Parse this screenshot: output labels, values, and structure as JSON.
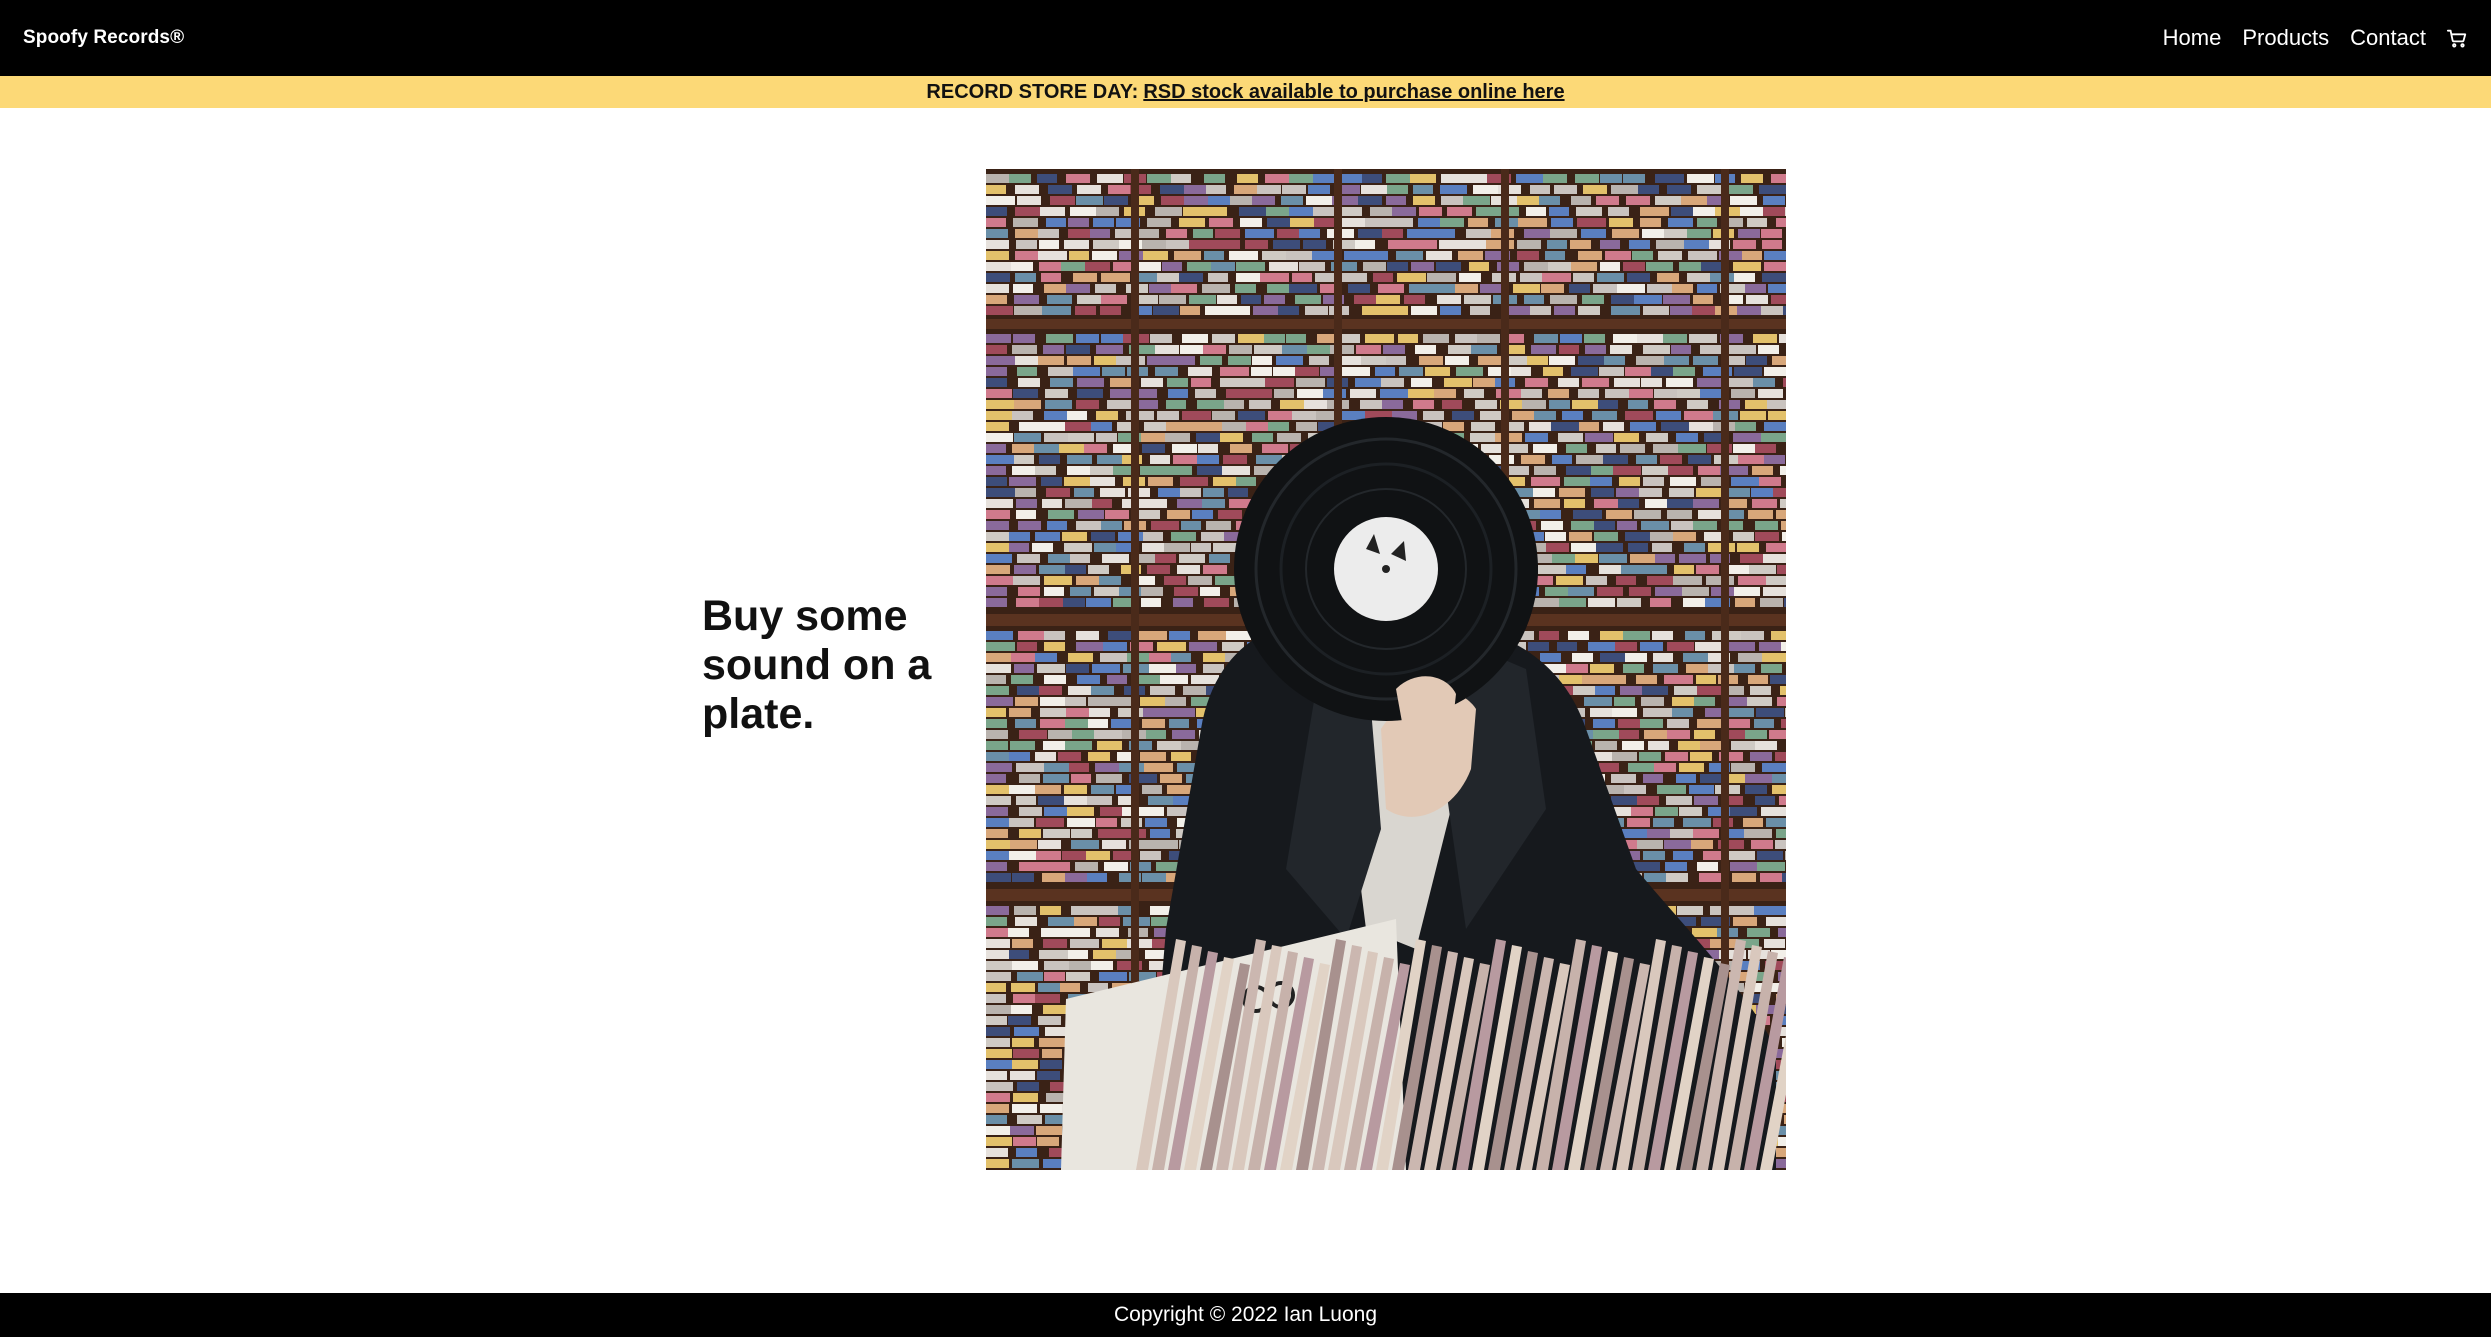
{
  "header": {
    "brand": "Spoofy Records®",
    "nav": [
      "Home",
      "Products",
      "Contact"
    ],
    "cart_icon": "shopping-cart-icon"
  },
  "banner": {
    "lead": "RECORD STORE DAY:",
    "link": "RSD stock available to purchase online here",
    "color": "#fcd977"
  },
  "hero": {
    "heading": "Buy some sound on a plate.",
    "photo_description": "person holding a vinyl record in front of their face in a record store"
  },
  "footer": {
    "copyright": "Copyright © 2022 Ian Luong"
  }
}
